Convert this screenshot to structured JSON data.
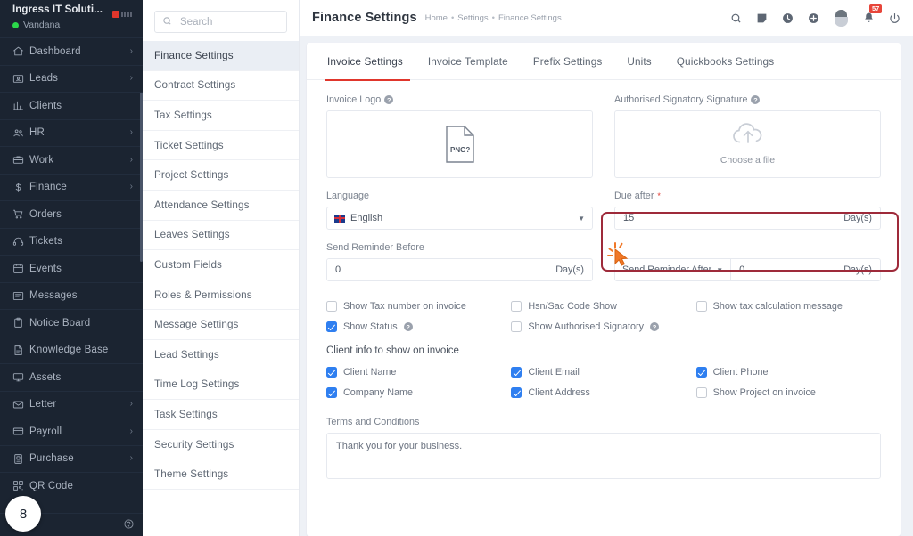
{
  "sidebar": {
    "company": "Ingress IT Soluti...",
    "user": "Vandana",
    "badge_count": "8",
    "items": [
      {
        "label": "Dashboard",
        "icon": "home-icon",
        "arrow": "›"
      },
      {
        "label": "Leads",
        "icon": "contact-card-icon",
        "arrow": "›"
      },
      {
        "label": "Clients",
        "icon": "bar-chart-icon",
        "arrow": ""
      },
      {
        "label": "HR",
        "icon": "people-icon",
        "arrow": "›"
      },
      {
        "label": "Work",
        "icon": "briefcase-icon",
        "arrow": "›"
      },
      {
        "label": "Finance",
        "icon": "dollar-icon",
        "arrow": "›"
      },
      {
        "label": "Orders",
        "icon": "cart-icon",
        "arrow": ""
      },
      {
        "label": "Tickets",
        "icon": "headset-icon",
        "arrow": ""
      },
      {
        "label": "Events",
        "icon": "calendar-icon",
        "arrow": ""
      },
      {
        "label": "Messages",
        "icon": "message-icon",
        "arrow": ""
      },
      {
        "label": "Notice Board",
        "icon": "clipboard-icon",
        "arrow": ""
      },
      {
        "label": "Knowledge Base",
        "icon": "book-icon",
        "arrow": ""
      },
      {
        "label": "Assets",
        "icon": "monitor-icon",
        "arrow": ""
      },
      {
        "label": "Letter",
        "icon": "envelope-icon",
        "arrow": "›"
      },
      {
        "label": "Payroll",
        "icon": "wallet-icon",
        "arrow": "›"
      },
      {
        "label": "Purchase",
        "icon": "receipt-icon",
        "arrow": "›"
      },
      {
        "label": "QR Code",
        "icon": "qr-icon",
        "arrow": ""
      }
    ]
  },
  "settings_menu": {
    "search_placeholder": "Search",
    "search_value": "",
    "items": [
      "Finance Settings",
      "Contract Settings",
      "Tax Settings",
      "Ticket Settings",
      "Project Settings",
      "Attendance Settings",
      "Leaves Settings",
      "Custom Fields",
      "Roles & Permissions",
      "Message Settings",
      "Lead Settings",
      "Time Log Settings",
      "Task Settings",
      "Security Settings",
      "Theme Settings"
    ],
    "active": "Finance Settings"
  },
  "header": {
    "title": "Finance Settings",
    "breadcrumb": [
      "Home",
      "Settings",
      "Finance Settings"
    ],
    "separator": "•",
    "notification_badge": "57",
    "icons": [
      "search-icon",
      "note-icon",
      "clock-icon",
      "plus-circle-icon",
      "avatar-icon",
      "bell-icon",
      "power-icon"
    ]
  },
  "tabs": [
    {
      "label": "Invoice Settings",
      "active": true
    },
    {
      "label": "Invoice Template",
      "active": false
    },
    {
      "label": "Prefix Settings",
      "active": false
    },
    {
      "label": "Units",
      "active": false
    },
    {
      "label": "Quickbooks Settings",
      "active": false
    }
  ],
  "form": {
    "invoice_logo_label": "Invoice Logo",
    "invoice_logo_filetype": "PNG?",
    "signature_label": "Authorised Signatory Signature",
    "signature_choose": "Choose a file",
    "language_label": "Language",
    "language_value": "English",
    "due_after_label": "Due after",
    "due_after_required": "*",
    "due_after_value": "15",
    "due_after_suffix": "Day(s)",
    "reminder_before_label": "Send Reminder Before",
    "reminder_before_value": "0",
    "reminder_before_suffix": "Day(s)",
    "reminder_after_prefix": "Send Reminder After",
    "reminder_after_value": "0",
    "reminder_after_suffix": "Day(s)"
  },
  "checkboxes": {
    "col1": [
      {
        "label": "Show Tax number on invoice",
        "checked": false,
        "help": false
      },
      {
        "label": "Show Status",
        "checked": true,
        "help": true
      }
    ],
    "col2": [
      {
        "label": "Hsn/Sac Code Show",
        "checked": false,
        "help": false
      },
      {
        "label": "Show Authorised Signatory",
        "checked": false,
        "help": true
      }
    ],
    "col3": [
      {
        "label": "Show tax calculation message",
        "checked": false,
        "help": false
      }
    ]
  },
  "client_info": {
    "title": "Client info to show on invoice",
    "col1": [
      {
        "label": "Client Name",
        "checked": true
      },
      {
        "label": "Company Name",
        "checked": true
      }
    ],
    "col2": [
      {
        "label": "Client Email",
        "checked": true
      },
      {
        "label": "Client Address",
        "checked": true
      }
    ],
    "col3": [
      {
        "label": "Client Phone",
        "checked": true
      },
      {
        "label": "Show Project on invoice",
        "checked": false
      }
    ]
  },
  "terms": {
    "label": "Terms and Conditions",
    "value": "Thank you for your business."
  },
  "colors": {
    "sidebar_bg": "#1b2431",
    "accent_red": "#e0362c",
    "checkbox_blue": "#2f7ff0",
    "highlight_border": "#9e2a3a",
    "cursor_orange": "#f07828"
  }
}
